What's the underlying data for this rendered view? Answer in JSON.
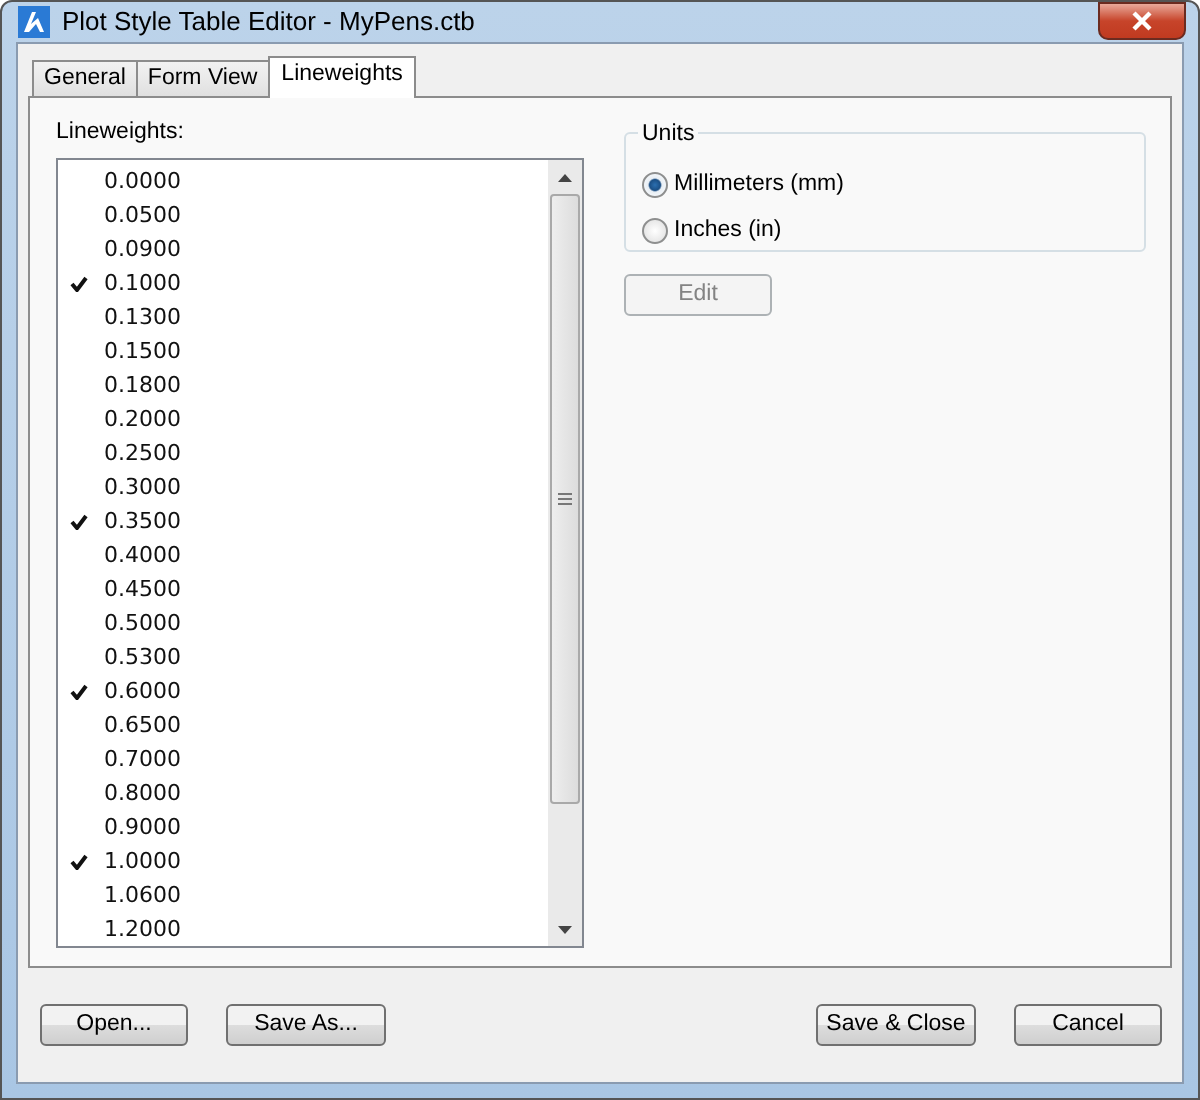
{
  "window": {
    "title": "Plot Style Table Editor - MyPens.ctb"
  },
  "tabs": [
    {
      "label": "General",
      "selected": false
    },
    {
      "label": "Form View",
      "selected": false
    },
    {
      "label": "Lineweights",
      "selected": true
    }
  ],
  "lineweights": {
    "label": "Lineweights:",
    "items": [
      {
        "value": "0.0000",
        "checked": false
      },
      {
        "value": "0.0500",
        "checked": false
      },
      {
        "value": "0.0900",
        "checked": false
      },
      {
        "value": "0.1000",
        "checked": true
      },
      {
        "value": "0.1300",
        "checked": false
      },
      {
        "value": "0.1500",
        "checked": false
      },
      {
        "value": "0.1800",
        "checked": false
      },
      {
        "value": "0.2000",
        "checked": false
      },
      {
        "value": "0.2500",
        "checked": false
      },
      {
        "value": "0.3000",
        "checked": false
      },
      {
        "value": "0.3500",
        "checked": true
      },
      {
        "value": "0.4000",
        "checked": false
      },
      {
        "value": "0.4500",
        "checked": false
      },
      {
        "value": "0.5000",
        "checked": false
      },
      {
        "value": "0.5300",
        "checked": false
      },
      {
        "value": "0.6000",
        "checked": true
      },
      {
        "value": "0.6500",
        "checked": false
      },
      {
        "value": "0.7000",
        "checked": false
      },
      {
        "value": "0.8000",
        "checked": false
      },
      {
        "value": "0.9000",
        "checked": false
      },
      {
        "value": "1.0000",
        "checked": true
      },
      {
        "value": "1.0600",
        "checked": false
      },
      {
        "value": "1.2000",
        "checked": false
      }
    ]
  },
  "units": {
    "title": "Units",
    "options": [
      {
        "label": "Millimeters (mm)",
        "selected": true
      },
      {
        "label": "Inches (in)",
        "selected": false
      }
    ]
  },
  "edit_button": {
    "label": "Edit",
    "disabled": true
  },
  "left_buttons": [
    "Open...",
    "Save As..."
  ],
  "right_buttons": [
    "Save & Close",
    "Cancel"
  ]
}
